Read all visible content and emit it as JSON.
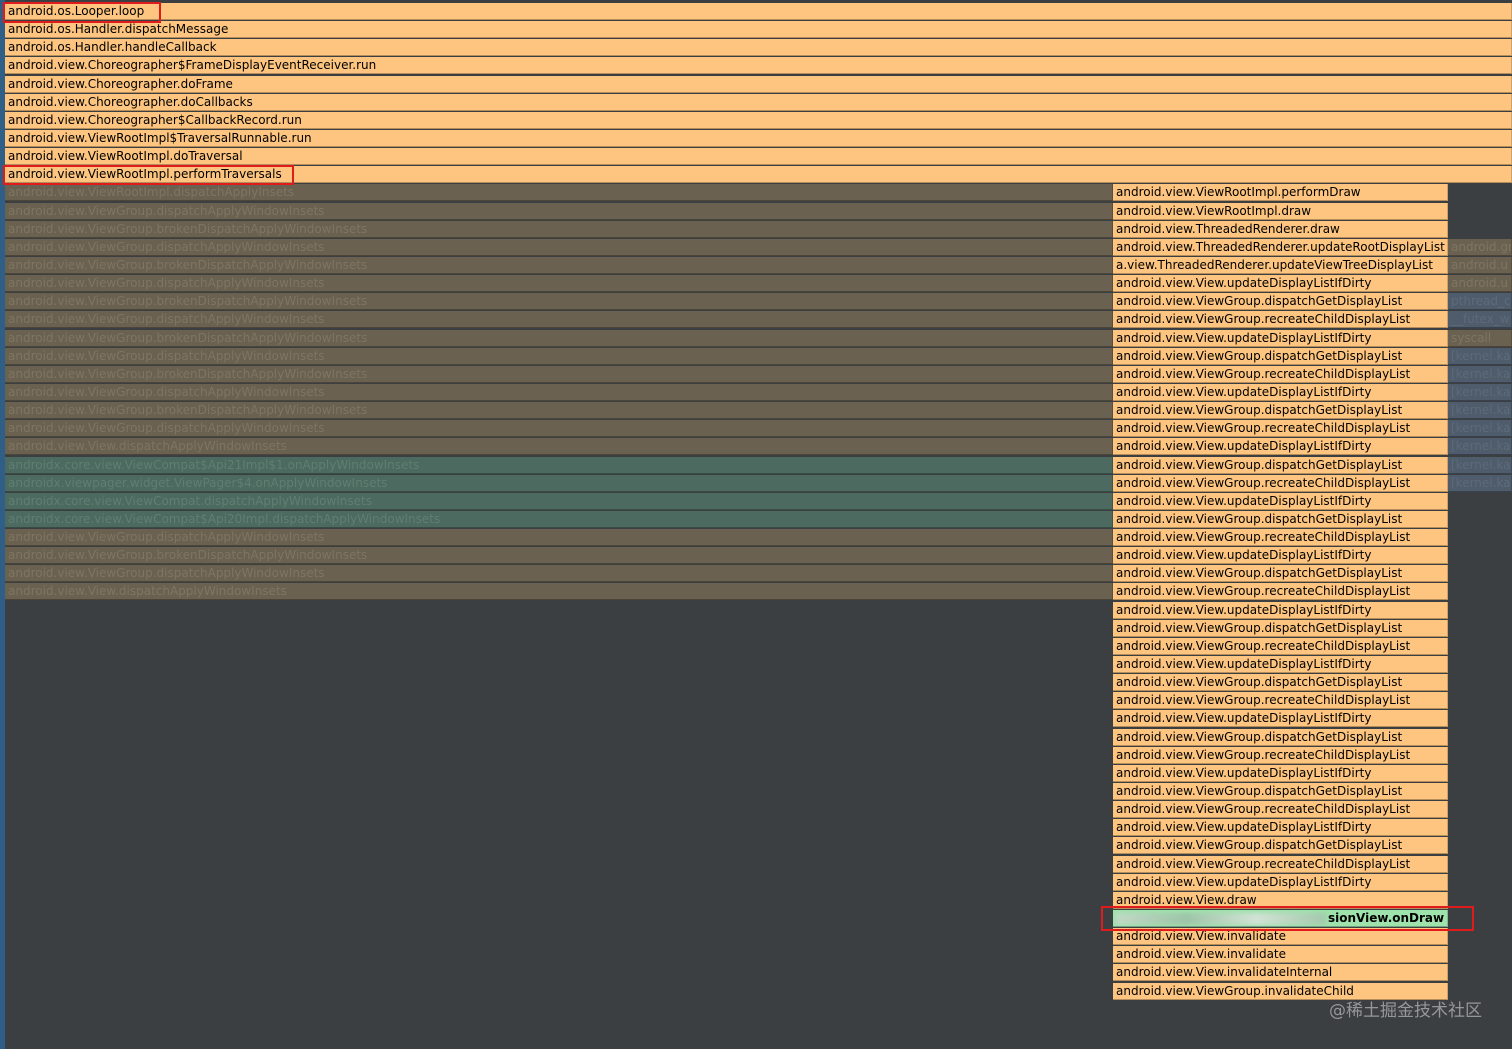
{
  "top_frames": [
    "android.os.Looper.loop",
    "android.os.Handler.dispatchMessage",
    "android.os.Handler.handleCallback",
    "android.view.Choreographer$FrameDisplayEventReceiver.run",
    "android.view.Choreographer.doFrame",
    "android.view.Choreographer.doCallbacks",
    "android.view.Choreographer$CallbackRecord.run",
    "android.view.ViewRootImpl$TraversalRunnable.run",
    "android.view.ViewRootImpl.doTraversal",
    "android.view.ViewRootImpl.performTraversals"
  ],
  "left_dim_frames": [
    {
      "label": "android.view.ViewRootImpl.dispatchApplyInsets",
      "tone": "brown"
    },
    {
      "label": "android.view.ViewGroup.dispatchApplyWindowInsets",
      "tone": "brown"
    },
    {
      "label": "android.view.ViewGroup.brokenDispatchApplyWindowInsets",
      "tone": "brown"
    },
    {
      "label": "android.view.ViewGroup.dispatchApplyWindowInsets",
      "tone": "brown"
    },
    {
      "label": "android.view.ViewGroup.brokenDispatchApplyWindowInsets",
      "tone": "brown"
    },
    {
      "label": "android.view.ViewGroup.dispatchApplyWindowInsets",
      "tone": "brown"
    },
    {
      "label": "android.view.ViewGroup.brokenDispatchApplyWindowInsets",
      "tone": "brown"
    },
    {
      "label": "android.view.ViewGroup.dispatchApplyWindowInsets",
      "tone": "brown"
    },
    {
      "label": "android.view.ViewGroup.brokenDispatchApplyWindowInsets",
      "tone": "brown"
    },
    {
      "label": "android.view.ViewGroup.dispatchApplyWindowInsets",
      "tone": "brown"
    },
    {
      "label": "android.view.ViewGroup.brokenDispatchApplyWindowInsets",
      "tone": "brown"
    },
    {
      "label": "android.view.ViewGroup.dispatchApplyWindowInsets",
      "tone": "brown"
    },
    {
      "label": "android.view.ViewGroup.brokenDispatchApplyWindowInsets",
      "tone": "brown"
    },
    {
      "label": "android.view.ViewGroup.dispatchApplyWindowInsets",
      "tone": "brown"
    },
    {
      "label": "android.view.View.dispatchApplyWindowInsets",
      "tone": "brown"
    },
    {
      "label": "androidx.core.view.ViewCompat$Api21Impl$1.onApplyWindowInsets",
      "tone": "green"
    },
    {
      "label": "androidx.viewpager.widget.ViewPager$4.onApplyWindowInsets",
      "tone": "green"
    },
    {
      "label": "androidx.core.view.ViewCompat.dispatchApplyWindowInsets",
      "tone": "green"
    },
    {
      "label": "androidx.core.view.ViewCompat$Api20Impl.dispatchApplyWindowInsets",
      "tone": "green"
    },
    {
      "label": "android.view.ViewGroup.dispatchApplyWindowInsets",
      "tone": "brown"
    },
    {
      "label": "android.view.ViewGroup.brokenDispatchApplyWindowInsets",
      "tone": "brown"
    },
    {
      "label": "android.view.ViewGroup.dispatchApplyWindowInsets",
      "tone": "brown"
    },
    {
      "label": "android.view.View.dispatchApplyWindowInsets",
      "tone": "brown"
    }
  ],
  "right_frames_upper": [
    "android.view.ViewRootImpl.performDraw",
    "android.view.ViewRootImpl.draw",
    "android.view.ThreadedRenderer.draw",
    "android.view.ThreadedRenderer.updateRootDisplayList",
    "a.view.ThreadedRenderer.updateViewTreeDisplayList",
    "android.view.View.updateDisplayListIfDirty",
    "android.view.ViewGroup.dispatchGetDisplayList",
    "android.view.ViewGroup.recreateChildDisplayList",
    "android.view.View.updateDisplayListIfDirty",
    "android.view.ViewGroup.dispatchGetDisplayList",
    "android.view.ViewGroup.recreateChildDisplayList",
    "android.view.View.updateDisplayListIfDirty",
    "android.view.ViewGroup.dispatchGetDisplayList",
    "android.view.ViewGroup.recreateChildDisplayList",
    "android.view.View.updateDisplayListIfDirty",
    "android.view.ViewGroup.dispatchGetDisplayList",
    "android.view.ViewGroup.recreateChildDisplayList",
    "android.view.View.updateDisplayListIfDirty",
    "android.view.ViewGroup.dispatchGetDisplayList",
    "android.view.ViewGroup.recreateChildDisplayList",
    "android.view.View.updateDisplayListIfDirty",
    "android.view.ViewGroup.dispatchGetDisplayList",
    "android.view.ViewGroup.recreateChildDisplayList",
    "android.view.View.updateDisplayListIfDirty",
    "android.view.ViewGroup.dispatchGetDisplayList",
    "android.view.ViewGroup.recreateChildDisplayList",
    "android.view.View.updateDisplayListIfDirty",
    "android.view.ViewGroup.dispatchGetDisplayList",
    "android.view.ViewGroup.recreateChildDisplayList",
    "android.view.View.updateDisplayListIfDirty",
    "android.view.ViewGroup.dispatchGetDisplayList",
    "android.view.ViewGroup.recreateChildDisplayList",
    "android.view.View.updateDisplayListIfDirty",
    "android.view.ViewGroup.dispatchGetDisplayList",
    "android.view.ViewGroup.recreateChildDisplayList",
    "android.view.View.updateDisplayListIfDirty",
    "android.view.ViewGroup.dispatchGetDisplayList",
    "android.view.ViewGroup.recreateChildDisplayList",
    "android.view.View.updateDisplayListIfDirty",
    "android.view.View.draw"
  ],
  "ondraw_frame": "sionView.onDraw",
  "right_frames_lower": [
    "android.view.View.invalidate",
    "android.view.View.invalidate",
    "android.view.View.invalidateInternal",
    "android.view.ViewGroup.invalidateChild"
  ],
  "far_right_frames": [
    {
      "label": "android.gr",
      "tone": "brown"
    },
    {
      "label": "android.u",
      "tone": "brown"
    },
    {
      "label": "android.u",
      "tone": "brown"
    },
    {
      "label": "pthread_c",
      "tone": "blue"
    },
    {
      "label": "__futex_w",
      "tone": "blue"
    },
    {
      "label": "syscall",
      "tone": "brown"
    },
    {
      "label": "[kernel.kall",
      "tone": "blue"
    },
    {
      "label": "[kernel.kall",
      "tone": "blue"
    },
    {
      "label": "[kernel.kall",
      "tone": "blue"
    },
    {
      "label": "[kernel.kall",
      "tone": "blue"
    },
    {
      "label": "[kernel.kall",
      "tone": "blue"
    },
    {
      "label": "[kernel.kall",
      "tone": "blue"
    },
    {
      "label": "[kernel.kall",
      "tone": "blue"
    },
    {
      "label": "[kernel.kall",
      "tone": "blue"
    }
  ],
  "watermark": "@稀土掘金技术社区"
}
